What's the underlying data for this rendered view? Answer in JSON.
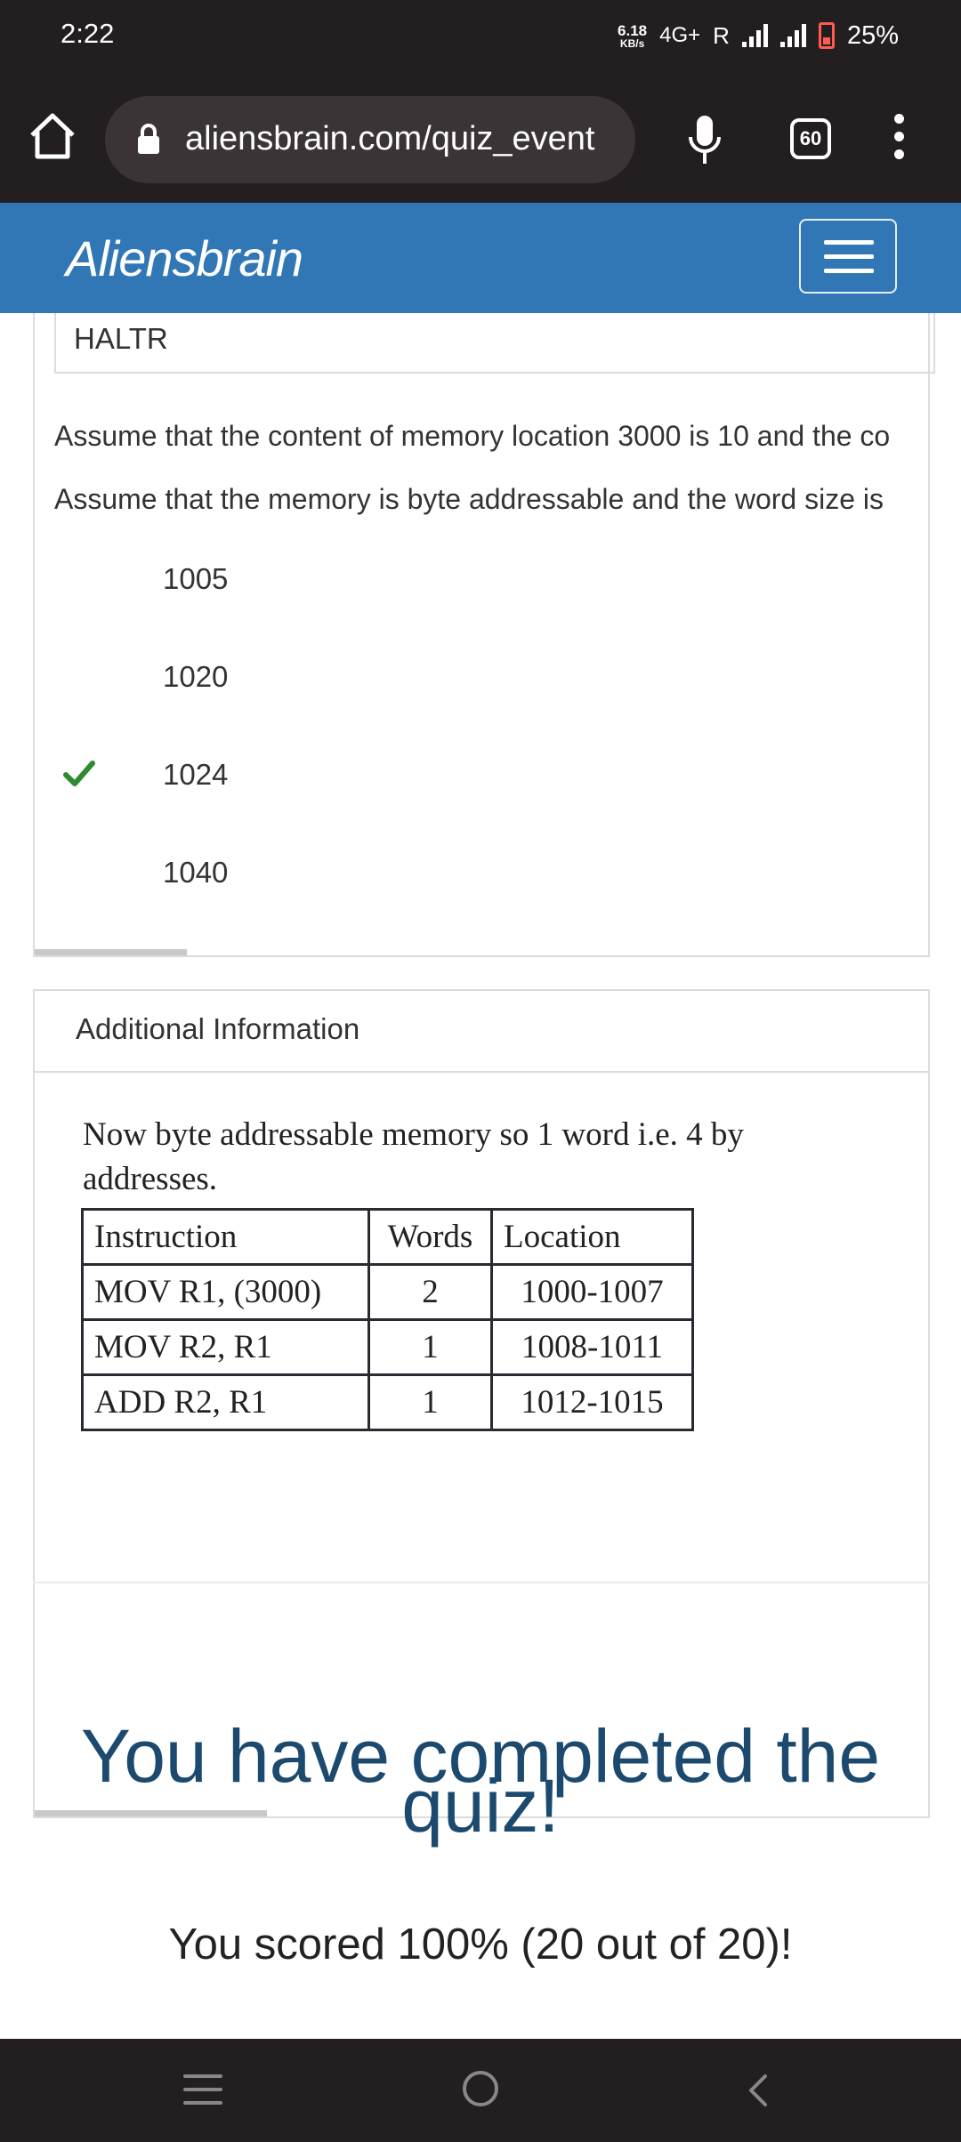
{
  "status_bar": {
    "time": "2:22",
    "net_speed_value": "6.18",
    "net_speed_unit": "KB/s",
    "network": "4G+",
    "roaming": "R",
    "battery": "25%"
  },
  "browser": {
    "url": "aliensbrain.com/quiz_event",
    "tab_count": "60"
  },
  "site": {
    "brand": "Aliensbrain"
  },
  "question": {
    "previous_option": "HALTR",
    "text_line1": "Assume that the content of memory location 3000 is 10 and the co",
    "text_line2": "Assume that the memory is byte addressable and the word size is",
    "options": [
      {
        "label": "1005",
        "correct": false
      },
      {
        "label": "1020",
        "correct": false
      },
      {
        "label": "1024",
        "correct": true
      },
      {
        "label": "1040",
        "correct": false
      }
    ],
    "scroll_fraction": 0.17
  },
  "additional_info": {
    "title": "Additional Information",
    "text_line1": "Now byte addressable memory so 1 word i.e. 4 by",
    "text_line2": "addresses.",
    "table": {
      "headers": [
        "Instruction",
        "Words",
        "Location"
      ],
      "rows": [
        [
          "MOV R1, (3000)",
          "2",
          "1000-1007"
        ],
        [
          "MOV R2, R1",
          "1",
          "1008-1011"
        ],
        [
          "ADD R2, R1",
          "1",
          "1012-1015"
        ]
      ]
    },
    "scroll_fraction": 0.26
  },
  "result": {
    "title_line1": "You have completed the",
    "title_line2": "quiz!",
    "score_text": "You scored 100% (20 out of 20)!"
  },
  "colors": {
    "navbar": "#3277b5",
    "title": "#1c4a6e",
    "check": "#2e8b2e",
    "system_bar": "#231f20"
  }
}
